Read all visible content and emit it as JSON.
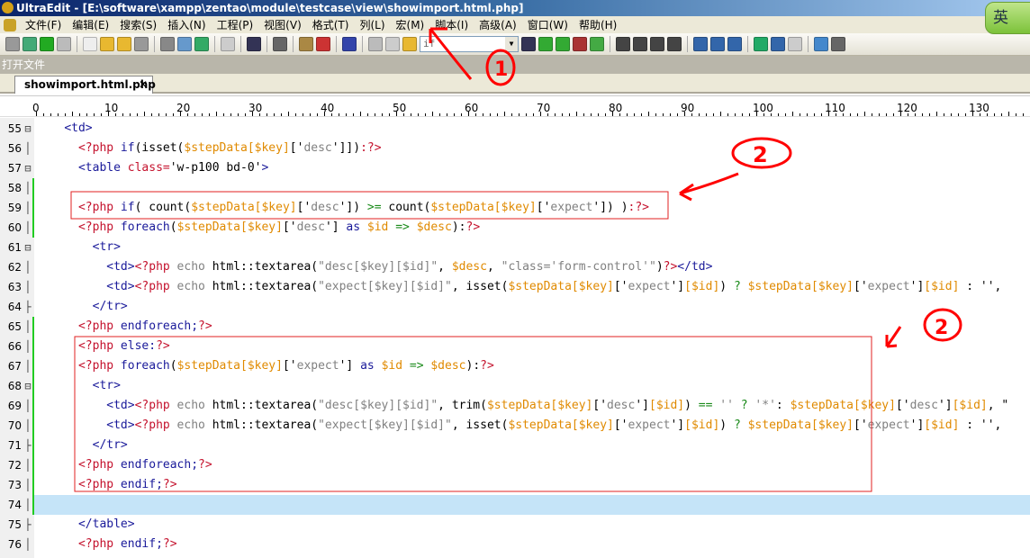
{
  "window": {
    "title": "UltraEdit - [E:\\software\\xampp\\zentao\\module\\testcase\\view\\showimport.html.php]"
  },
  "ime": {
    "label": "英"
  },
  "menu": [
    "文件(F)",
    "编辑(E)",
    "搜索(S)",
    "插入(N)",
    "工程(P)",
    "视图(V)",
    "格式(T)",
    "列(L)",
    "宏(M)",
    "脚本(I)",
    "高级(A)",
    "窗口(W)",
    "帮助(H)"
  ],
  "toolbar": {
    "search_value": "if"
  },
  "panel": {
    "title": "打开文件"
  },
  "tabs": [
    {
      "label": "showimport.html.php",
      "close": "✕"
    }
  ],
  "ruler": [
    "0",
    "10",
    "20",
    "30",
    "40",
    "50",
    "60",
    "70",
    "80",
    "90",
    "100",
    "110",
    "120",
    "130"
  ],
  "annotations": {
    "circle1": "1",
    "circle2a": "2",
    "circle2b": "2"
  },
  "colors": {
    "red_annotation": "#ff0000",
    "change_bar": "#22cc22",
    "current_line": "#c5e4f8"
  },
  "lines": [
    {
      "n": "55",
      "fold": "⊟",
      "chg": false,
      "tokens": [
        [
          "    ",
          "n"
        ],
        [
          "<td>",
          "t"
        ]
      ]
    },
    {
      "n": "56",
      "fold": "│",
      "chg": false,
      "tokens": [
        [
          "      ",
          "n"
        ],
        [
          "<?php",
          "p"
        ],
        [
          " if",
          "k"
        ],
        [
          "(isset(",
          "n"
        ],
        [
          "$stepData[$key]",
          "v"
        ],
        [
          "['",
          "n"
        ],
        [
          "desc",
          "s"
        ],
        [
          "']])",
          "n"
        ],
        [
          ":?>",
          "p"
        ]
      ]
    },
    {
      "n": "57",
      "fold": "⊟",
      "chg": false,
      "tokens": [
        [
          "      ",
          "n"
        ],
        [
          "<table ",
          "t"
        ],
        [
          "class=",
          "p"
        ],
        [
          "'w-p100 bd-0'",
          "n"
        ],
        [
          ">",
          "t"
        ]
      ]
    },
    {
      "n": "58",
      "fold": "│",
      "chg": true,
      "tokens": []
    },
    {
      "n": "59",
      "fold": "│",
      "chg": true,
      "tokens": [
        [
          "      ",
          "n"
        ],
        [
          "<?php",
          "p"
        ],
        [
          " if",
          "k"
        ],
        [
          "( count(",
          "n"
        ],
        [
          "$stepData[$key]",
          "v"
        ],
        [
          "['",
          "n"
        ],
        [
          "desc",
          "s"
        ],
        [
          "']) ",
          "n"
        ],
        [
          ">=",
          "o"
        ],
        [
          " count(",
          "n"
        ],
        [
          "$stepData[$key]",
          "v"
        ],
        [
          "['",
          "n"
        ],
        [
          "expect",
          "s"
        ],
        [
          "']) )",
          "n"
        ],
        [
          ":?>",
          "p"
        ]
      ]
    },
    {
      "n": "60",
      "fold": "│",
      "chg": true,
      "tokens": [
        [
          "      ",
          "n"
        ],
        [
          "<?php",
          "p"
        ],
        [
          " foreach",
          "k"
        ],
        [
          "(",
          "n"
        ],
        [
          "$stepData[$key]",
          "v"
        ],
        [
          "['",
          "n"
        ],
        [
          "desc",
          "s"
        ],
        [
          "'] ",
          "n"
        ],
        [
          "as ",
          "k"
        ],
        [
          "$id ",
          "v"
        ],
        [
          "=> ",
          "o"
        ],
        [
          "$desc",
          "v"
        ],
        [
          "):",
          "n"
        ],
        [
          "?>",
          "p"
        ]
      ]
    },
    {
      "n": "61",
      "fold": "⊟",
      "chg": false,
      "tokens": [
        [
          "        ",
          "n"
        ],
        [
          "<tr>",
          "t"
        ]
      ]
    },
    {
      "n": "62",
      "fold": "│",
      "chg": false,
      "tokens": [
        [
          "          ",
          "n"
        ],
        [
          "<td>",
          "t"
        ],
        [
          "<?php",
          "p"
        ],
        [
          " echo ",
          "e"
        ],
        [
          "html::textarea(",
          "n"
        ],
        [
          "\"desc[$key][$id]\"",
          "s"
        ],
        [
          ", ",
          "n"
        ],
        [
          "$desc",
          "v"
        ],
        [
          ", ",
          "n"
        ],
        [
          "\"class='form-control'\"",
          "s"
        ],
        [
          ")",
          "n"
        ],
        [
          "?>",
          "p"
        ],
        [
          "</td>",
          "t"
        ]
      ]
    },
    {
      "n": "63",
      "fold": "│",
      "chg": false,
      "tokens": [
        [
          "          ",
          "n"
        ],
        [
          "<td>",
          "t"
        ],
        [
          "<?php",
          "p"
        ],
        [
          " echo ",
          "e"
        ],
        [
          "html::textarea(",
          "n"
        ],
        [
          "\"expect[$key][$id]\"",
          "s"
        ],
        [
          ", isset(",
          "n"
        ],
        [
          "$stepData[$key]",
          "v"
        ],
        [
          "['",
          "n"
        ],
        [
          "expect",
          "s"
        ],
        [
          "']",
          "n"
        ],
        [
          "[$id]",
          "v"
        ],
        [
          ") ",
          "n"
        ],
        [
          "? ",
          "o"
        ],
        [
          "$stepData[$key]",
          "v"
        ],
        [
          "['",
          "n"
        ],
        [
          "expect",
          "s"
        ],
        [
          "']",
          "n"
        ],
        [
          "[$id]",
          "v"
        ],
        [
          " : '',",
          "n"
        ]
      ]
    },
    {
      "n": "64",
      "fold": "├",
      "chg": false,
      "tokens": [
        [
          "        ",
          "n"
        ],
        [
          "</tr>",
          "t"
        ]
      ]
    },
    {
      "n": "65",
      "fold": "│",
      "chg": true,
      "tokens": [
        [
          "      ",
          "n"
        ],
        [
          "<?php",
          "p"
        ],
        [
          " endforeach;",
          "k"
        ],
        [
          "?>",
          "p"
        ]
      ]
    },
    {
      "n": "66",
      "fold": "│",
      "chg": true,
      "tokens": [
        [
          "      ",
          "n"
        ],
        [
          "<?php",
          "p"
        ],
        [
          " else:",
          "k"
        ],
        [
          "?>",
          "p"
        ]
      ]
    },
    {
      "n": "67",
      "fold": "│",
      "chg": true,
      "tokens": [
        [
          "      ",
          "n"
        ],
        [
          "<?php",
          "p"
        ],
        [
          " foreach",
          "k"
        ],
        [
          "(",
          "n"
        ],
        [
          "$stepData[$key]",
          "v"
        ],
        [
          "['",
          "n"
        ],
        [
          "expect",
          "s"
        ],
        [
          "'] ",
          "n"
        ],
        [
          "as ",
          "k"
        ],
        [
          "$id ",
          "v"
        ],
        [
          "=> ",
          "o"
        ],
        [
          "$desc",
          "v"
        ],
        [
          "):",
          "n"
        ],
        [
          "?>",
          "p"
        ]
      ]
    },
    {
      "n": "68",
      "fold": "⊟",
      "chg": true,
      "tokens": [
        [
          "        ",
          "n"
        ],
        [
          "<tr>",
          "t"
        ]
      ]
    },
    {
      "n": "69",
      "fold": "│",
      "chg": true,
      "tokens": [
        [
          "          ",
          "n"
        ],
        [
          "<td>",
          "t"
        ],
        [
          "<?php",
          "p"
        ],
        [
          " echo ",
          "e"
        ],
        [
          "html::textarea(",
          "n"
        ],
        [
          "\"desc[$key][$id]\"",
          "s"
        ],
        [
          ", trim(",
          "n"
        ],
        [
          "$stepData[$key]",
          "v"
        ],
        [
          "['",
          "n"
        ],
        [
          "desc",
          "s"
        ],
        [
          "']",
          "n"
        ],
        [
          "[$id]",
          "v"
        ],
        [
          ") ",
          "n"
        ],
        [
          "==",
          "o"
        ],
        [
          " '' ",
          "s"
        ],
        [
          "? ",
          "o"
        ],
        [
          "'*'",
          "s"
        ],
        [
          ": ",
          "n"
        ],
        [
          "$stepData[$key]",
          "v"
        ],
        [
          "['",
          "n"
        ],
        [
          "desc",
          "s"
        ],
        [
          "']",
          "n"
        ],
        [
          "[$id]",
          "v"
        ],
        [
          ", \"",
          "n"
        ]
      ]
    },
    {
      "n": "70",
      "fold": "│",
      "chg": true,
      "tokens": [
        [
          "          ",
          "n"
        ],
        [
          "<td>",
          "t"
        ],
        [
          "<?php",
          "p"
        ],
        [
          " echo ",
          "e"
        ],
        [
          "html::textarea(",
          "n"
        ],
        [
          "\"expect[$key][$id]\"",
          "s"
        ],
        [
          ", isset(",
          "n"
        ],
        [
          "$stepData[$key]",
          "v"
        ],
        [
          "['",
          "n"
        ],
        [
          "expect",
          "s"
        ],
        [
          "']",
          "n"
        ],
        [
          "[$id]",
          "v"
        ],
        [
          ") ",
          "n"
        ],
        [
          "? ",
          "o"
        ],
        [
          "$stepData[$key]",
          "v"
        ],
        [
          "['",
          "n"
        ],
        [
          "expect",
          "s"
        ],
        [
          "']",
          "n"
        ],
        [
          "[$id]",
          "v"
        ],
        [
          " : '',",
          "n"
        ]
      ]
    },
    {
      "n": "71",
      "fold": "├",
      "chg": true,
      "tokens": [
        [
          "        ",
          "n"
        ],
        [
          "</tr>",
          "t"
        ]
      ]
    },
    {
      "n": "72",
      "fold": "│",
      "chg": true,
      "tokens": [
        [
          "      ",
          "n"
        ],
        [
          "<?php",
          "p"
        ],
        [
          " endforeach;",
          "k"
        ],
        [
          "?>",
          "p"
        ]
      ]
    },
    {
      "n": "73",
      "fold": "│",
      "chg": true,
      "tokens": [
        [
          "      ",
          "n"
        ],
        [
          "<?php",
          "p"
        ],
        [
          " endif;",
          "k"
        ],
        [
          "?>",
          "p"
        ]
      ]
    },
    {
      "n": "74",
      "fold": "│",
      "chg": true,
      "current": true,
      "tokens": []
    },
    {
      "n": "75",
      "fold": "├",
      "chg": false,
      "tokens": [
        [
          "      ",
          "n"
        ],
        [
          "</table>",
          "t"
        ]
      ]
    },
    {
      "n": "76",
      "fold": "│",
      "chg": false,
      "tokens": [
        [
          "      ",
          "n"
        ],
        [
          "<?php",
          "p"
        ],
        [
          " endif;",
          "k"
        ],
        [
          "?>",
          "p"
        ]
      ]
    }
  ]
}
